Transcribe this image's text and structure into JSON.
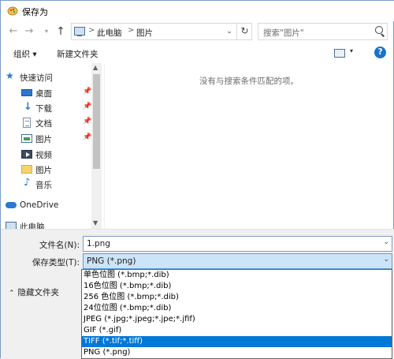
{
  "window": {
    "title": "保存为"
  },
  "address": {
    "crumbs": [
      "此电脑",
      "图片"
    ],
    "separator": ">",
    "search_placeholder": "搜索\"图片\""
  },
  "toolbar": {
    "organize": "组织 ▾",
    "new_folder": "新建文件夹"
  },
  "nav_pane": {
    "quick_access": "快速访问",
    "items": [
      {
        "label": "桌面",
        "icon": "desktop-icon",
        "pinned": true
      },
      {
        "label": "下载",
        "icon": "download-icon",
        "pinned": true
      },
      {
        "label": "文档",
        "icon": "document-icon",
        "pinned": true
      },
      {
        "label": "图片",
        "icon": "pictures-icon",
        "pinned": true
      },
      {
        "label": "视频",
        "icon": "video-icon",
        "pinned": false
      },
      {
        "label": "图片",
        "icon": "folder-icon",
        "pinned": false
      },
      {
        "label": "音乐",
        "icon": "music-icon",
        "pinned": false
      }
    ],
    "onedrive": "OneDrive",
    "this_pc": "此电脑"
  },
  "content": {
    "empty_message": "没有与搜索条件匹配的项。"
  },
  "form": {
    "filename_label": "文件名(N):",
    "filename_value": "1.png",
    "filetype_label": "保存类型(T):",
    "filetype_value": "PNG (*.png)",
    "hide_folders": "隐藏文件夹"
  },
  "filetype_options": [
    "单色位图 (*.bmp;*.dib)",
    "16色位图 (*.bmp;*.dib)",
    "256 色位图 (*.bmp;*.dib)",
    "24位位图 (*.bmp;*.dib)",
    "JPEG (*.jpg;*.jpeg;*.jpe;*.jfif)",
    "GIF (*.gif)",
    "TIFF (*.tif;*.tiff)",
    "PNG (*.png)"
  ],
  "selected_option_index": 6,
  "colors": {
    "accent": "#0078d7",
    "selection_bg": "#cce4f7",
    "border": "#7a9cc6"
  }
}
